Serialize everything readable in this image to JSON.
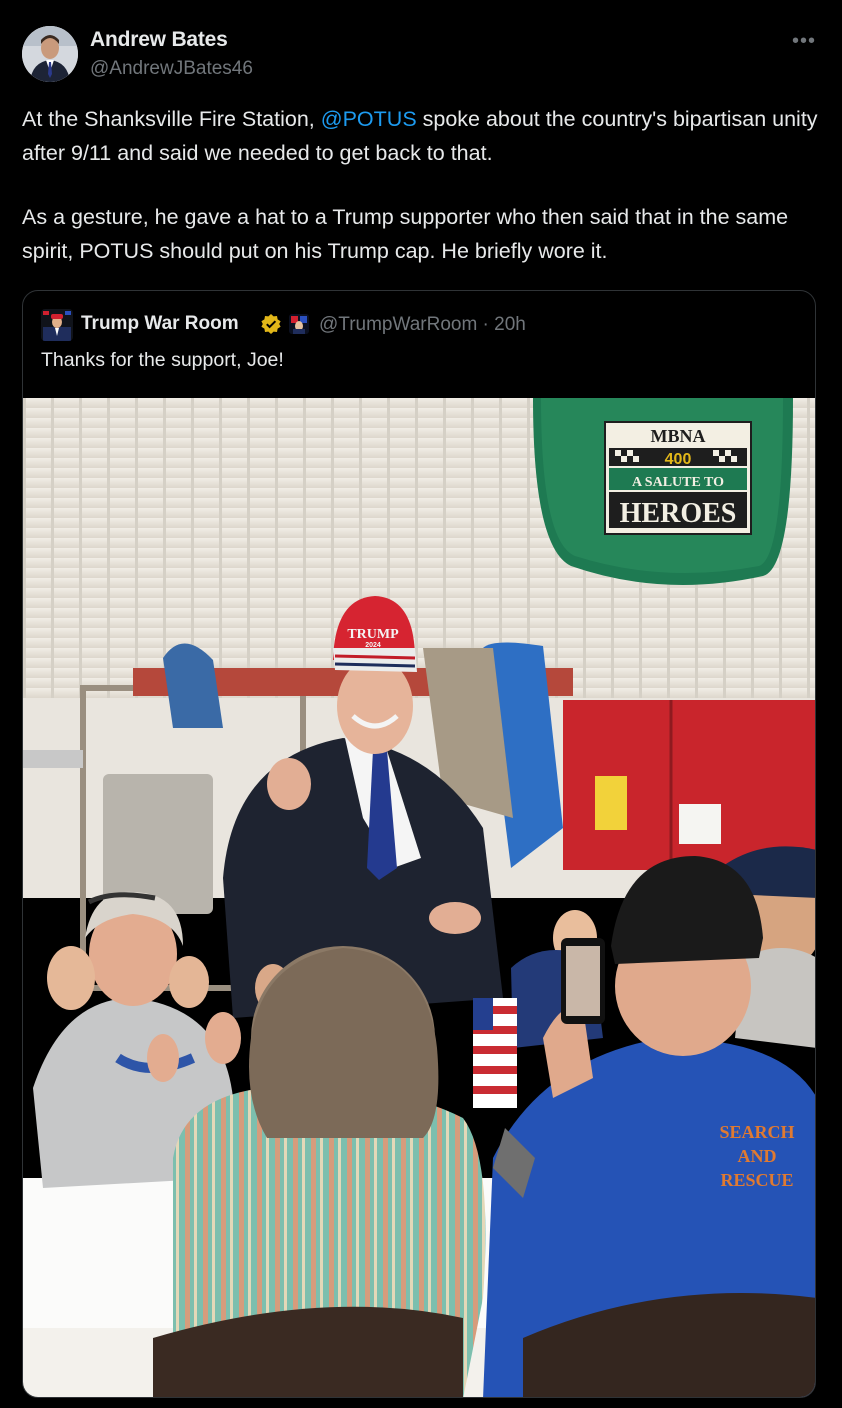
{
  "post": {
    "author_name": "Andrew Bates",
    "author_handle": "@AndrewJBates46",
    "more_icon": "•••",
    "text_p1_before": "At the Shanksville Fire Station, ",
    "text_p1_mention": "@POTUS",
    "text_p1_after": " spoke about the country's bipartisan unity after 9/11 and said we needed to get back to that.",
    "text_p2": "As a gesture, he gave a hat to a Trump supporter who then said that in the  same spirit, POTUS should put on his Trump cap. He briefly wore it."
  },
  "quoted": {
    "author_name": "Trump War Room",
    "meta": "@TrumpWarRoom · 20h",
    "text": "Thanks for the support, Joe!",
    "verified_color": "#e2b719"
  },
  "photo": {
    "banner_line1": "MBNA",
    "banner_line2": "400",
    "banner_line3": "A SALUTE TO",
    "banner_line4": "HEROES",
    "cap_text": "TRUMP",
    "cap_year": "2024",
    "shirt_text_1": "SEARCH",
    "shirt_text_2": "AND",
    "shirt_text_3": "RESCUE"
  },
  "colors": {
    "background": "#000000",
    "text": "#e7e9ea",
    "secondary": "#71767b",
    "link": "#1d9bf0",
    "border": "#2f3336"
  }
}
